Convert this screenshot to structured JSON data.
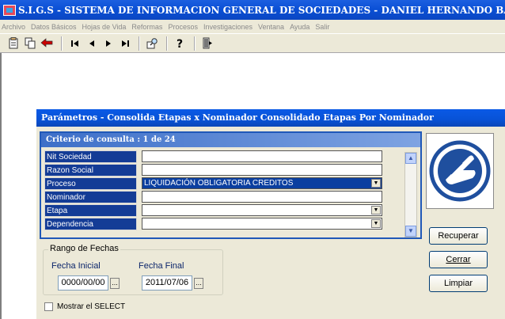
{
  "window": {
    "title": "S.I.G.S   - SISTEMA DE INFORMACION GENERAL DE SOCIEDADES - DANIEL HERNANDO BARRAGAN CASTRO"
  },
  "menu": {
    "items": [
      "Archivo",
      "Datos Básicos",
      "Hojas de Vida",
      "Reformas",
      "Procesos",
      "Investigaciones",
      "Ventana",
      "Ayuda",
      "Salir"
    ]
  },
  "toolbar": {
    "icons": [
      "paste-icon",
      "copy-icon",
      "back-arrow-icon",
      "first-record-icon",
      "previous-record-icon",
      "next-record-icon",
      "last-record-icon",
      "search-icon",
      "help-icon",
      "exit-door-icon"
    ]
  },
  "dialog": {
    "title": "Parámetros - Consolida Etapas x Nominador Consolidado Etapas Por Nominador",
    "criteria_header": "Criterio de consulta : 1  de  24",
    "criteria": [
      {
        "label": "Nit Sociedad",
        "value": "",
        "dropdown": false
      },
      {
        "label": "Razon Social",
        "value": "",
        "dropdown": false
      },
      {
        "label": "Proceso",
        "value": "LIQUIDACIÓN OBLIGATORIA CREDITOS",
        "dropdown": true
      },
      {
        "label": "Nominador",
        "value": "",
        "dropdown": false
      },
      {
        "label": "Etapa",
        "value": "",
        "dropdown": true
      },
      {
        "label": "Dependencia",
        "value": "",
        "dropdown": true
      }
    ],
    "buttons": {
      "recuperar": "Recuperar",
      "cerrar": "Cerrar",
      "limpiar": "Limpiar"
    },
    "date_range": {
      "legend": "Rango de Fechas",
      "start_label": "Fecha Inicial",
      "start_value": "0000/00/00",
      "end_label": "Fecha Final",
      "end_value": "2011/07/06",
      "picker_label": "..."
    },
    "show_select_label": "Mostrar el SELECT"
  },
  "colors": {
    "titlebar": "#0a4fd4",
    "label_bg": "#143c96",
    "selected_field": "#0b3fa0",
    "face": "#ece9d8"
  }
}
